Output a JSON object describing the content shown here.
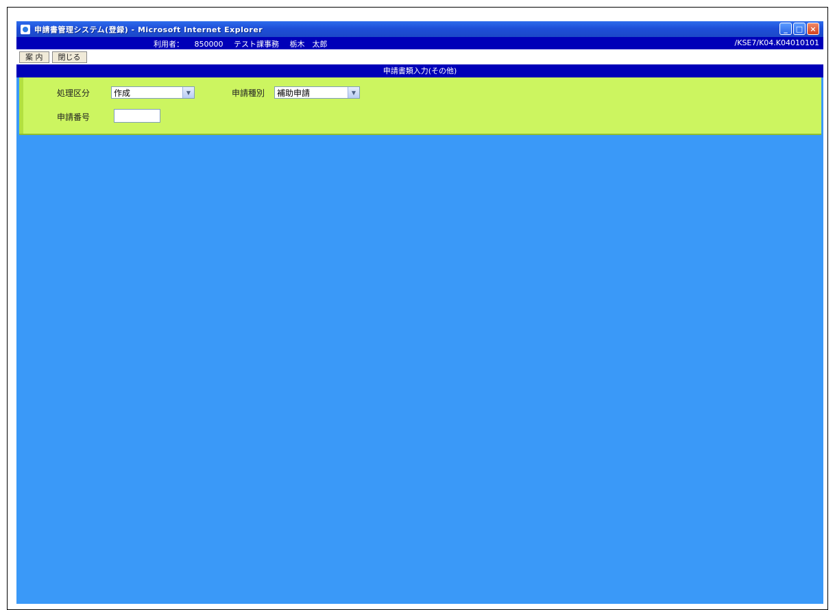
{
  "window": {
    "title": "申請書管理システム(登録) - Microsoft Internet Explorer",
    "controls": {
      "minimize": "_",
      "maximize": "□",
      "close": "×"
    }
  },
  "userbar": {
    "user_label": "利用者：",
    "user_id": "850000",
    "department": "テスト課事務",
    "name": "栃木　太郎",
    "screen_id": "/KSE7/K04.K04010101"
  },
  "toolbar": {
    "guide_label": "案 内",
    "close_label": "閉じる"
  },
  "page": {
    "heading": "申請書類入力(その他)"
  },
  "form": {
    "process_label": "処理区分",
    "process_value": "作成",
    "type_label": "申請種別",
    "type_value": "補助申請",
    "number_label": "申請番号",
    "number_value": ""
  },
  "colors": {
    "titlebar": "#1e4fd8",
    "header_bar": "#0000b8",
    "panel": "#ccf560",
    "workspace": "#3a99f8"
  }
}
